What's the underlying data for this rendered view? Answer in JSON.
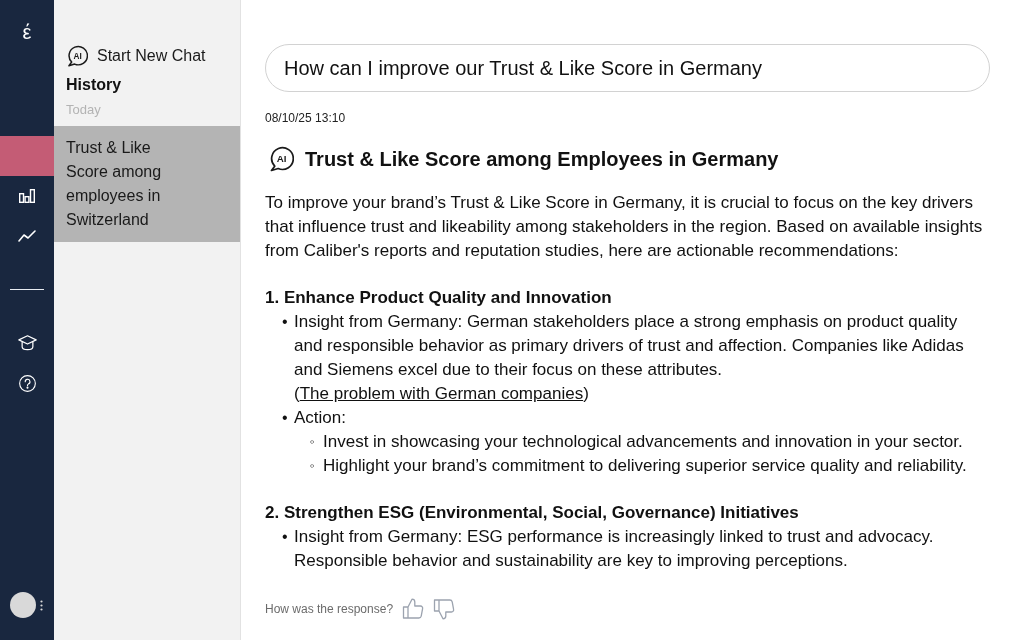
{
  "rail": {
    "logo": "έ",
    "groups": [
      {
        "items": [
          {
            "selected": true
          },
          {
            "selected": false
          },
          {
            "selected": false
          }
        ]
      },
      {
        "items": [
          {
            "selected": false
          },
          {
            "selected": false
          }
        ]
      }
    ]
  },
  "side_panel": {
    "new_chat": {
      "icon_text": "AI",
      "label": "Start New Chat"
    },
    "history_title": "History",
    "groups": [
      {
        "label": "Today",
        "items": [
          {
            "title": "Trust & Like Score among employees in Switzerland",
            "selected": true
          }
        ]
      }
    ]
  },
  "user_message": {
    "text": "How can I improve our Trust & Like Score in Germany"
  },
  "response": {
    "timestamp": "08/10/25 13:10",
    "icon_text": "AI",
    "title": "Trust & Like Score among Employees in Germany",
    "intro": "To improve your brand’s Trust & Like Score in Germany, it is crucial to focus on the key drivers that influence trust and likeability among stakeholders in the region. Based on available insights from Caliber's reports and reputation studies, here are actionable recommendations:",
    "sections": [
      {
        "heading": "1. Enhance Product Quality and Innovation",
        "bullets": [
          {
            "marker": "•",
            "text": "Insight from Germany: German stakeholders place a strong emphasis on product quality and responsible behavior as primary drivers of trust and affection. Companies like Adidas and Siemens excel due to their focus on these attributes. (",
            "link": "The problem with German companies",
            "text_after": ")"
          },
          {
            "marker": "•",
            "text": "Action:",
            "children": [
              {
                "marker": "◦",
                "text": "Invest in showcasing your technological advancements and innovation in your sector."
              },
              {
                "marker": "◦",
                "text": "Highlight your brand’s commitment to delivering superior service quality and reliability."
              }
            ]
          }
        ]
      },
      {
        "heading": "2. Strengthen ESG (Environmental, Social, Governance) Initiatives",
        "bullets": [
          {
            "marker": "•",
            "text": "Insight from Germany: ESG performance is increasingly linked to trust and advocacy. Responsible behavior and sustainability are key to improving perceptions."
          }
        ]
      }
    ]
  },
  "feedback": {
    "prompt": "How was the response?"
  }
}
